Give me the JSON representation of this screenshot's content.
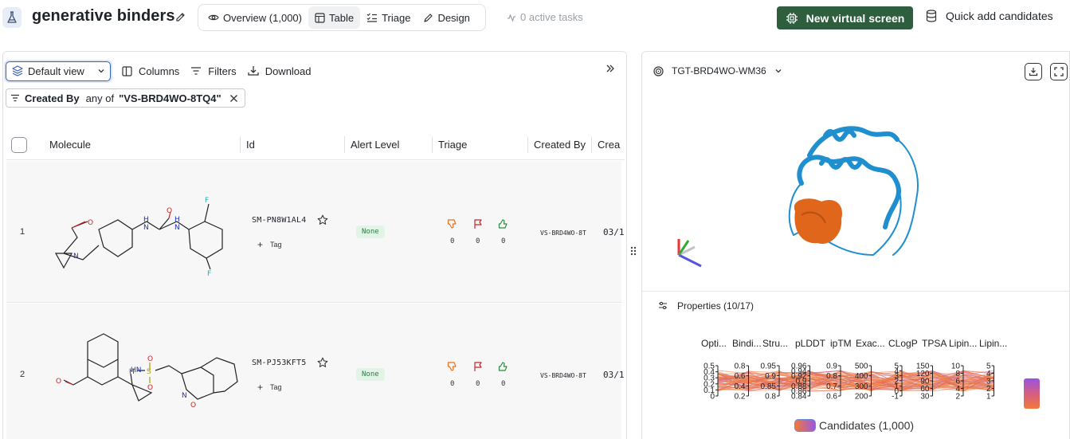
{
  "header": {
    "title": "generative binders",
    "tabs": [
      {
        "label": "Overview (1,000)",
        "icon": "eye-icon",
        "active": false
      },
      {
        "label": "Table",
        "icon": "table-icon",
        "active": true
      },
      {
        "label": "Triage",
        "icon": "checklist-icon",
        "active": false
      },
      {
        "label": "Design",
        "icon": "pen-icon",
        "active": false
      }
    ],
    "tasks_label": "0 active tasks",
    "primary_button": "New virtual screen",
    "quick_add": "Quick add candidates"
  },
  "toolbar": {
    "view_label": "Default view",
    "columns_label": "Columns",
    "filters_label": "Filters",
    "download_label": "Download"
  },
  "filter": {
    "field": "Created By",
    "operator": "any of",
    "value": "\"VS-BRD4WO-8TQ4\""
  },
  "table": {
    "columns": [
      "Molecule",
      "Id",
      "Alert Level",
      "Triage",
      "Created By",
      "Crea"
    ],
    "rows": [
      {
        "index": "1",
        "id": "SM-PN8W1AL4",
        "tag": "Tag",
        "alert": "None",
        "down": "0",
        "flag": "0",
        "up": "0",
        "created_by": "VS-BRD4WO-8T",
        "created": "03/1"
      },
      {
        "index": "2",
        "id": "SM-PJ53KFT5",
        "tag": "Tag",
        "alert": "None",
        "down": "0",
        "flag": "0",
        "up": "0",
        "created_by": "VS-BRD4WO-8T",
        "created": "03/1"
      }
    ]
  },
  "viewer": {
    "target": "TGT-BRD4WO-WM36",
    "properties_label": "Properties (10/17)",
    "axes": [
      {
        "label": "Opti...",
        "ticks": [
          "0.5",
          "0.4",
          "0.3",
          "0.2",
          "0.1",
          "0"
        ]
      },
      {
        "label": "Bindi...",
        "ticks": [
          "0.8",
          "0.6",
          "0.4",
          "0.2"
        ]
      },
      {
        "label": "Stru...",
        "ticks": [
          "0.95",
          "0.9",
          "0.85",
          "0.8"
        ]
      },
      {
        "label": "pLDDT",
        "ticks": [
          "0.96",
          "0.94",
          "0.92",
          "0.9",
          "0.88",
          "0.86",
          "0.84"
        ]
      },
      {
        "label": "ipTM",
        "ticks": [
          "0.9",
          "0.8",
          "0.7",
          "0.6"
        ]
      },
      {
        "label": "Exac...",
        "ticks": [
          "500",
          "400",
          "300",
          "200"
        ]
      },
      {
        "label": "CLogP",
        "ticks": [
          "5",
          "4",
          "3",
          "2",
          "1",
          "0",
          "-1"
        ]
      },
      {
        "label": "TPSA",
        "ticks": [
          "150",
          "120",
          "90",
          "60",
          "30"
        ]
      },
      {
        "label": "Lipin...",
        "ticks": [
          "10",
          "8",
          "6",
          "4",
          "2"
        ]
      },
      {
        "label": "Lipin...",
        "ticks": [
          "5",
          "4",
          "3",
          "2",
          "1"
        ]
      }
    ],
    "legend_label": "Candidates (1,000)"
  },
  "colors": {
    "primary": "#2e5e3e",
    "protein": "#1f8fd0",
    "ligand": "#e0661c",
    "alert_none_bg": "#e1f4e6",
    "thumbs_down": "#e6711f",
    "flag": "#c62828",
    "thumbs_up": "#2e8b3e"
  }
}
